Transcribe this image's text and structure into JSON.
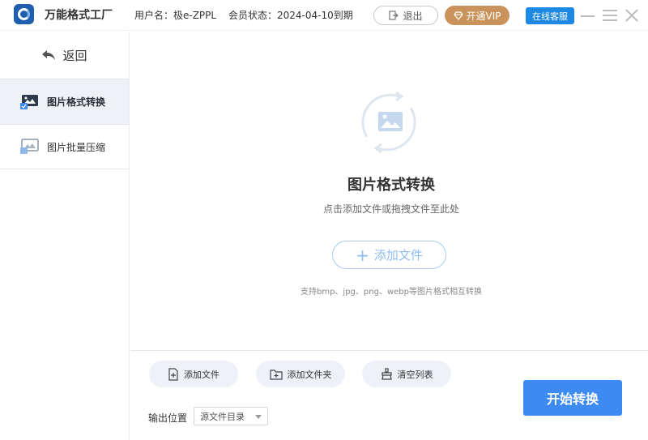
{
  "app": {
    "title": "万能格式工厂"
  },
  "header": {
    "user": "用户名：极e-ZPPL",
    "member": "会员状态：2024-04-10到期",
    "logout_label": "退出",
    "vip_label": "开通VIP",
    "service_label": "在线客服"
  },
  "sidebar": {
    "back_label": "返回",
    "items": [
      {
        "label": "图片格式转换",
        "active": true
      },
      {
        "label": "图片批量压缩",
        "active": false
      }
    ]
  },
  "main": {
    "title": "图片格式转换",
    "subtitle": "点击添加文件或拖拽文件至此处",
    "add_file_label": "添加文件",
    "support_text": "支持bmp、jpg、png、webp等图片格式相互转换"
  },
  "toolbar": {
    "add_file_label": "添加文件",
    "add_folder_label": "添加文件夹",
    "clear_label": "清空列表",
    "output_label": "输出位置",
    "output_value": "源文件目录",
    "start_label": "开始转换"
  },
  "colors": {
    "accent": "#3d8bf2",
    "vip": "#c9935b",
    "service": "#1e88e5",
    "sidebar_active": "#eef2f8"
  }
}
